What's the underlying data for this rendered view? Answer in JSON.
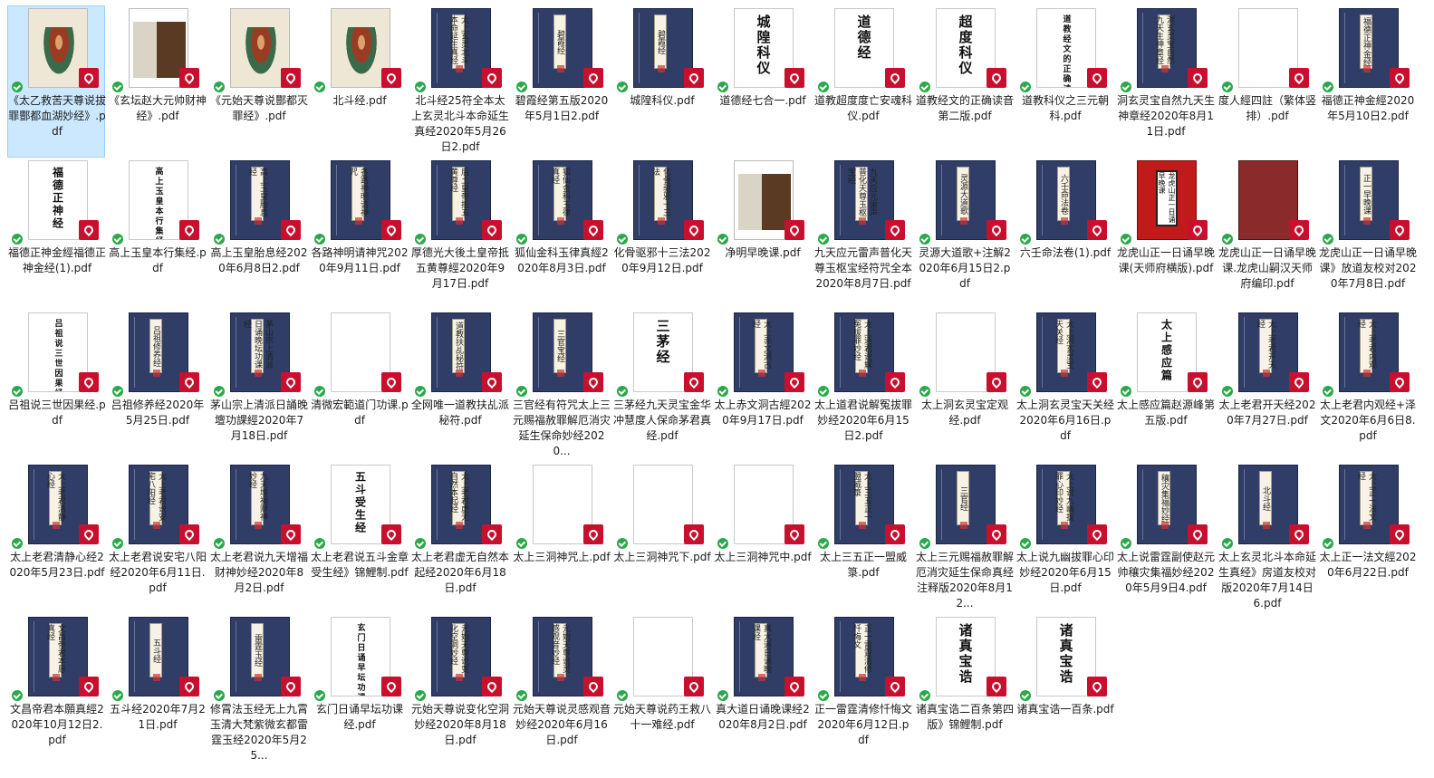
{
  "files": [
    {
      "name": "《太乙救苦天尊说拔罪酆都血湖妙经》.pdf",
      "thumb": "photo",
      "selected": true
    },
    {
      "name": "《玄坛赵大元帅财神经》.pdf",
      "thumb": "photo2"
    },
    {
      "name": "《元始天尊说酆都灭罪经》.pdf",
      "thumb": "photo"
    },
    {
      "name": "北斗经.pdf",
      "thumb": "photo"
    },
    {
      "name": "北斗经25符全本太上玄灵北斗本命延生真经2020年5月26日2.pdf",
      "thumb": "blue",
      "cover": "太上玄灵北斗本命延生真经"
    },
    {
      "name": "碧霞经第五版2020年5月1日2.pdf",
      "thumb": "blue",
      "cover": "碧霞经"
    },
    {
      "name": "城隍科仪.pdf",
      "thumb": "blue",
      "cover": "碧霞经"
    },
    {
      "name": "道德经七合一.pdf",
      "thumb": "white",
      "cover": "城隍科仪"
    },
    {
      "name": "道教超度度亡安魂科仪.pdf",
      "thumb": "white",
      "cover": "道德经"
    },
    {
      "name": "道教经文的正确读音第二版.pdf",
      "thumb": "white",
      "cover": "超度科仪"
    },
    {
      "name": "道教科仪之三元朝科.pdf",
      "thumb": "white",
      "cover": "道教经文的正确读音"
    },
    {
      "name": "洞玄灵宝自然九天生神章经2020年8月11日.pdf",
      "thumb": "blue",
      "cover": "洞玄灵宝自然九天生神章经"
    },
    {
      "name": "度人經四註（繁体竖排）.pdf",
      "thumb": "white",
      "cover": ""
    },
    {
      "name": "福德正神金經2020年5月10日2.pdf",
      "thumb": "blue",
      "cover": "福德正神金经"
    },
    {
      "name": "福德正神金經福德正神金经(1).pdf",
      "thumb": "white",
      "cover": "福德正神经"
    },
    {
      "name": "高上玉皇本行集经.pdf",
      "thumb": "white",
      "cover": "高上玉皇本行集经"
    },
    {
      "name": "高上玉皇胎息经2020年6月8日2.pdf",
      "thumb": "blue",
      "cover": "高上玉皇胎息经"
    },
    {
      "name": "各路神明请神咒2020年9月11日.pdf",
      "thumb": "blue",
      "cover": "各路神明请神咒"
    },
    {
      "name": "厚德光大後土皇帝抵五黄尊經2020年9月17日.pdf",
      "thumb": "blue",
      "cover": "后土皇帝抵五黄尊经"
    },
    {
      "name": "狐仙金科玉律真經2020年8月3日.pdf",
      "thumb": "blue",
      "cover": "狐仙金科玉律真经"
    },
    {
      "name": "化骨驱邪十三法2020年9月12日.pdf",
      "thumb": "blue",
      "cover": "化骨驱邪十三法"
    },
    {
      "name": "净明早晚课.pdf",
      "thumb": "photo2",
      "cover": ""
    },
    {
      "name": "九天应元雷声普化天尊玉枢宝经符咒全本2020年8月7日.pdf",
      "thumb": "blue",
      "cover": "九天应元雷声普化天尊玉枢宝经"
    },
    {
      "name": "灵源大道歌+注解2020年6月15日2.pdf",
      "thumb": "blue",
      "cover": "灵源大道歌"
    },
    {
      "name": "六壬命法卷(1).pdf",
      "thumb": "blue",
      "cover": "六壬命法卷"
    },
    {
      "name": "龙虎山正一日诵早晚课(天师府横版).pdf",
      "thumb": "red",
      "cover": "龙虎山正一日诵早晚课"
    },
    {
      "name": "龙虎山正一日诵早晚课.龙虎山嗣汉天师府编印.pdf",
      "thumb": "darkred",
      "cover": ""
    },
    {
      "name": "龙虎山正一日诵早晚课》放道友校对2020年7月8日.pdf",
      "thumb": "blue",
      "cover": "正一早晚课"
    },
    {
      "name": "吕祖说三世因果经.pdf",
      "thumb": "white",
      "cover": "吕祖说三世因果经"
    },
    {
      "name": "吕祖修养经2020年5月25日.pdf",
      "thumb": "blue",
      "cover": "吕祖修养经"
    },
    {
      "name": "茅山宗上清派日誦晚壇功課經2020年7月18日.pdf",
      "thumb": "blue",
      "cover": "茅山宗上清派日诵晚坛功课经"
    },
    {
      "name": "清微宏範道门功课.pdf",
      "thumb": "white",
      "cover": ""
    },
    {
      "name": "全网唯一道教扶乩派秘符.pdf",
      "thumb": "blue",
      "cover": "道教扶乩秘符"
    },
    {
      "name": "三官经有符咒太上三元赐福赦罪解厄消灾延生保命妙经2020...",
      "thumb": "blue",
      "cover": "三官宝经"
    },
    {
      "name": "三茅经九天灵宝金华冲慧度人保命茅君真经.pdf",
      "thumb": "white",
      "cover": "三茅经"
    },
    {
      "name": "太上赤文洞古經2020年9月17日.pdf",
      "thumb": "blue",
      "cover": "太上赤文洞古经"
    },
    {
      "name": "太上道君说解冤拔罪妙经2020年6月15日2.pdf",
      "thumb": "blue",
      "cover": "太上道君说解冤拔罪妙经"
    },
    {
      "name": "太上洞玄灵宝定观经.pdf",
      "thumb": "white",
      "cover": ""
    },
    {
      "name": "太上洞玄灵宝天关经2020年6月16日.pdf",
      "thumb": "blue",
      "cover": "太上洞玄灵宝天关经"
    },
    {
      "name": "太上感应篇赵源峰第五版.pdf",
      "thumb": "white",
      "cover": "太上感应篇"
    },
    {
      "name": "太上老君开天经2020年7月27日.pdf",
      "thumb": "blue",
      "cover": "太上老君开天经"
    },
    {
      "name": "太上老君内观经+泽文2020年6月6日8.pdf",
      "thumb": "blue",
      "cover": "太上老君内观经"
    },
    {
      "name": "太上老君清静心经2020年5月23日.pdf",
      "thumb": "blue",
      "cover": "太上老君清静心经"
    },
    {
      "name": "太上老君说安宅八阳经2020年6月11日.pdf",
      "thumb": "blue",
      "cover": "太上老君说安宅八阳经"
    },
    {
      "name": "太上老君说九天增福财神妙经2020年8月2日.pdf",
      "thumb": "blue",
      "cover": "九天增福财神妙经"
    },
    {
      "name": "太上老君说五斗金章受生经》锦鯉制.pdf",
      "thumb": "white",
      "cover": "五斗受生经"
    },
    {
      "name": "太上老君虚无自然本起经2020年6月18日.pdf",
      "thumb": "blue",
      "cover": "太上老君虚无自然本起经"
    },
    {
      "name": "太上三洞神咒上.pdf",
      "thumb": "white",
      "cover": ""
    },
    {
      "name": "太上三洞神咒下.pdf",
      "thumb": "white",
      "cover": ""
    },
    {
      "name": "太上三洞神咒中.pdf",
      "thumb": "white",
      "cover": ""
    },
    {
      "name": "太上三五正一盟威箓.pdf",
      "thumb": "blue",
      "cover": "太上三五正一盟威箓"
    },
    {
      "name": "太上三元赐福赦罪解厄消灾延生保命真经注释版2020年8月12...",
      "thumb": "blue",
      "cover": "三官经"
    },
    {
      "name": "太上说九幽拔罪心印妙经2020年6月15日.pdf",
      "thumb": "blue",
      "cover": "太上说九幽拔罪心印妙经"
    },
    {
      "name": "太上说雷霆副使赵元帅穰灾集福妙经2020年5月9日4.pdf",
      "thumb": "blue",
      "cover": "穰灾集福妙经"
    },
    {
      "name": "太上玄灵北斗本命延生真经》房道友校对版2020年7月14日6.pdf",
      "thumb": "blue",
      "cover": "北斗经"
    },
    {
      "name": "太上正一法文經2020年6月22日.pdf",
      "thumb": "blue",
      "cover": "太上正一法文经"
    },
    {
      "name": "文昌帝君本願真經2020年10月12日2.pdf",
      "thumb": "blue",
      "cover": "文昌帝君本愿真经"
    },
    {
      "name": "五斗经2020年7月21日.pdf",
      "thumb": "blue",
      "cover": "五斗经"
    },
    {
      "name": "修霄法玉经无上九霄玉清大梵紫微玄都雷霆玉经2020年5月25...",
      "thumb": "blue",
      "cover": "雷霆玉经"
    },
    {
      "name": "玄门日诵早坛功课经.pdf",
      "thumb": "white",
      "cover": "玄门日诵早坛功课经"
    },
    {
      "name": "元始天尊说变化空洞妙经2020年8月18日.pdf",
      "thumb": "blue",
      "cover": "元始天尊说变化空洞妙经"
    },
    {
      "name": "元始天尊说灵感观音妙经2020年6月16日.pdf",
      "thumb": "blue",
      "cover": "元始天尊说灵感观音妙经"
    },
    {
      "name": "元始天尊说药王救八十一难经.pdf",
      "thumb": "white",
      "cover": ""
    },
    {
      "name": "真大道日诵晚课经2020年8月2日.pdf",
      "thumb": "blue",
      "cover": "真大道日诵晚课经"
    },
    {
      "name": "正一雷霆清修忏悔文2020年6月12日.pdf",
      "thumb": "blue",
      "cover": "正一雷霆清修忏悔文"
    },
    {
      "name": "诸真宝诰二百条第四版》锦鲤制.pdf",
      "thumb": "white",
      "cover": "诸真宝诰"
    },
    {
      "name": "诸真宝诰一百条.pdf",
      "thumb": "white",
      "cover": "诸真宝诰"
    }
  ],
  "icons": {
    "file_type": "pdf-icon",
    "status": "check-icon"
  },
  "colors": {
    "selection": "#cce8ff",
    "book_blue": "#2f3d67",
    "pdf_red": "#c8102e",
    "status_green": "#2aa84a"
  }
}
